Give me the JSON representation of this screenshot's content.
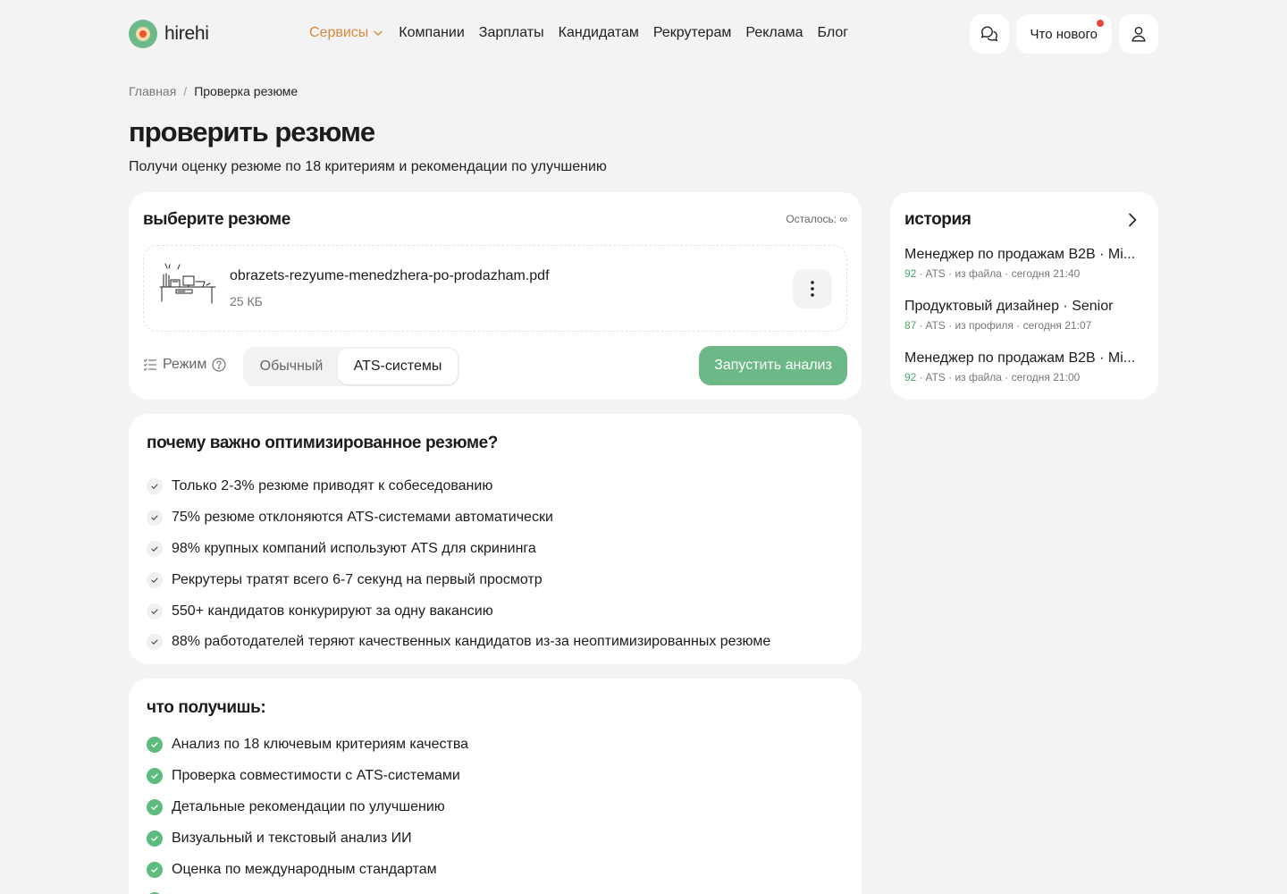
{
  "brand": {
    "name": "hirehi"
  },
  "nav": {
    "items": [
      "Сервисы",
      "Компании",
      "Зарплаты",
      "Кандидатам",
      "Рекрутерам",
      "Реклама",
      "Блог"
    ],
    "active_color": "#d38a3d"
  },
  "header": {
    "news_label": "Что нового"
  },
  "breadcrumb": {
    "home": "Главная",
    "separator": "/",
    "current": "Проверка резюме"
  },
  "page": {
    "title": "проверить резюме",
    "subtitle": "Получи оценку резюме по 18 критериям и рекомендации по улучшению"
  },
  "select_card": {
    "title": "выберите резюме",
    "remaining": "Осталось: ∞",
    "file": {
      "name": "obrazets-rezyume-menedzhera-po-prodazham.pdf",
      "size": "25 КБ"
    },
    "mode_label": "Режим",
    "modes": [
      "Обычный",
      "ATS-системы"
    ],
    "selected_mode": "ATS-системы",
    "run_button": "Запустить анализ",
    "accent_color": "#6cb987"
  },
  "history": {
    "title": "история",
    "items": [
      {
        "title": "Менеджер по продажам B2B · Mi...",
        "score": "92",
        "meta": " · ATS · из файла · сегодня 21:40"
      },
      {
        "title": "Продуктовый дизайнер · Senior",
        "score": "87",
        "meta": " · ATS · из профиля · сегодня 21:07"
      },
      {
        "title": "Менеджер по продажам B2B · Mi...",
        "score": "92",
        "meta": " · ATS · из файла · сегодня 21:00"
      }
    ]
  },
  "why": {
    "title": "почему важно оптимизированное резюме?",
    "items": [
      "Только 2-3% резюме приводят к собеседованию",
      "75% резюме отклоняются ATS-системами автоматически",
      "98% крупных компаний используют ATS для скрининга",
      "Рекрутеры тратят всего 6-7 секунд на первый просмотр",
      "550+ кандидатов конкурируют за одну вакансию",
      "88% работодателей теряют качественных кандидатов из-за неоптимизированных резюме"
    ]
  },
  "get": {
    "title": "что получишь:",
    "items": [
      "Анализ по 18 ключевым критериям качества",
      "Проверка совместимости с ATS-системами",
      "Детальные рекомендации по улучшению",
      "Визуальный и текстовый анализ ИИ",
      "Оценка по международным стандартам"
    ]
  }
}
